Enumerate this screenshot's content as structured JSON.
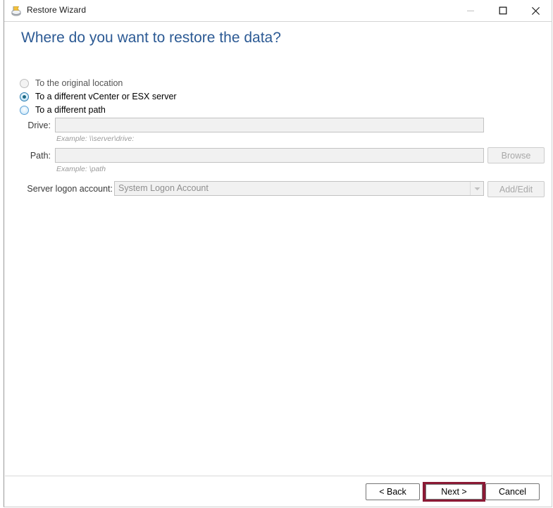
{
  "window": {
    "title": "Restore Wizard",
    "icon": "restore-disc-icon",
    "controls": {
      "minimize": "minimize-icon",
      "maximize": "maximize-icon",
      "close": "close-icon"
    }
  },
  "page": {
    "heading": "Where do you want to restore the data?",
    "heading_color": "#2c5a94"
  },
  "destination_options": [
    {
      "id": "original",
      "label": "To the original location",
      "selected": false,
      "enabled": false
    },
    {
      "id": "vcenter",
      "label": "To a different vCenter or ESX server",
      "selected": true,
      "enabled": true
    },
    {
      "id": "path",
      "label": "To a different path",
      "selected": false,
      "enabled": true
    }
  ],
  "fields": {
    "drive": {
      "label": "Drive:",
      "value": "",
      "placeholder": "",
      "hint": "Example: \\\\server\\drive:",
      "enabled": false
    },
    "path": {
      "label": "Path:",
      "value": "",
      "placeholder": "",
      "hint": "Example: \\path",
      "enabled": false
    },
    "server_logon_account": {
      "label": "Server logon account:",
      "value": "System Logon Account",
      "enabled": false,
      "options": [
        "System Logon Account"
      ]
    }
  },
  "buttons": {
    "browse": {
      "label": "Browse",
      "enabled": false
    },
    "add_edit": {
      "label": "Add/Edit",
      "enabled": false
    },
    "back": {
      "label": "< Back",
      "enabled": true
    },
    "next": {
      "label": "Next >",
      "enabled": true,
      "focus_border_color": "#8b1a35"
    },
    "cancel": {
      "label": "Cancel",
      "enabled": true
    }
  }
}
